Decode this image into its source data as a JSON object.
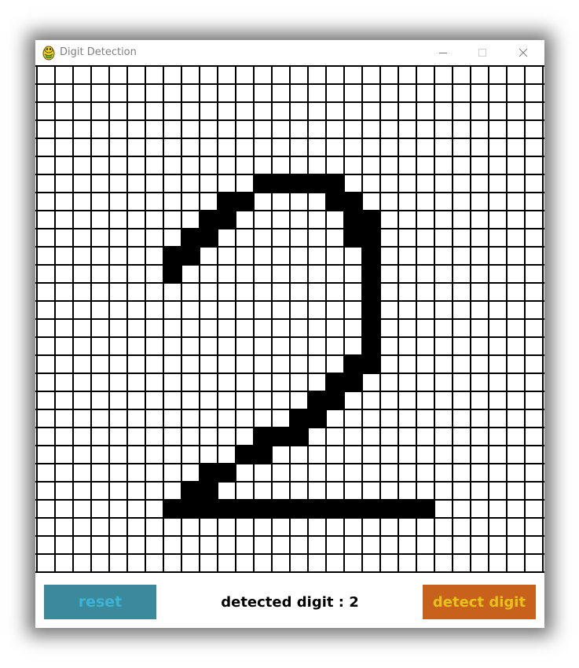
{
  "window": {
    "title": "Digit Detection",
    "icon": "pygame-snake-icon",
    "controls": [
      "minimize-icon",
      "maximize-icon",
      "close-icon"
    ]
  },
  "canvas": {
    "columns": 28,
    "rows": 28,
    "grid_color": "#000000",
    "background_color": "#ffffff",
    "fill_color": "#000000",
    "filled_cells": [
      [
        6,
        12
      ],
      [
        6,
        13
      ],
      [
        6,
        14
      ],
      [
        6,
        15
      ],
      [
        6,
        16
      ],
      [
        7,
        10
      ],
      [
        7,
        11
      ],
      [
        7,
        16
      ],
      [
        7,
        17
      ],
      [
        8,
        9
      ],
      [
        8,
        10
      ],
      [
        8,
        17
      ],
      [
        8,
        18
      ],
      [
        9,
        8
      ],
      [
        9,
        9
      ],
      [
        9,
        17
      ],
      [
        9,
        18
      ],
      [
        10,
        7
      ],
      [
        10,
        8
      ],
      [
        10,
        18
      ],
      [
        11,
        7
      ],
      [
        11,
        18
      ],
      [
        12,
        18
      ],
      [
        13,
        18
      ],
      [
        14,
        18
      ],
      [
        15,
        18
      ],
      [
        16,
        17
      ],
      [
        16,
        18
      ],
      [
        17,
        16
      ],
      [
        17,
        17
      ],
      [
        18,
        15
      ],
      [
        18,
        16
      ],
      [
        19,
        14
      ],
      [
        19,
        15
      ],
      [
        20,
        12
      ],
      [
        20,
        13
      ],
      [
        20,
        14
      ],
      [
        21,
        11
      ],
      [
        21,
        12
      ],
      [
        22,
        9
      ],
      [
        22,
        10
      ],
      [
        23,
        8
      ],
      [
        23,
        9
      ],
      [
        24,
        7
      ],
      [
        24,
        8
      ],
      [
        24,
        9
      ],
      [
        24,
        10
      ],
      [
        24,
        11
      ],
      [
        24,
        12
      ],
      [
        24,
        13
      ],
      [
        24,
        14
      ],
      [
        24,
        15
      ],
      [
        24,
        16
      ],
      [
        24,
        17
      ],
      [
        24,
        18
      ],
      [
        24,
        19
      ],
      [
        24,
        20
      ],
      [
        24,
        21
      ]
    ]
  },
  "controls": {
    "reset_label": "reset",
    "detect_label": "detect digit",
    "reset_bg": "#3a8a9b",
    "reset_fg": "#3fb3d6",
    "detect_bg": "#c8611b",
    "detect_fg": "#e6c21b"
  },
  "status": {
    "text": "detected digit : 2"
  }
}
